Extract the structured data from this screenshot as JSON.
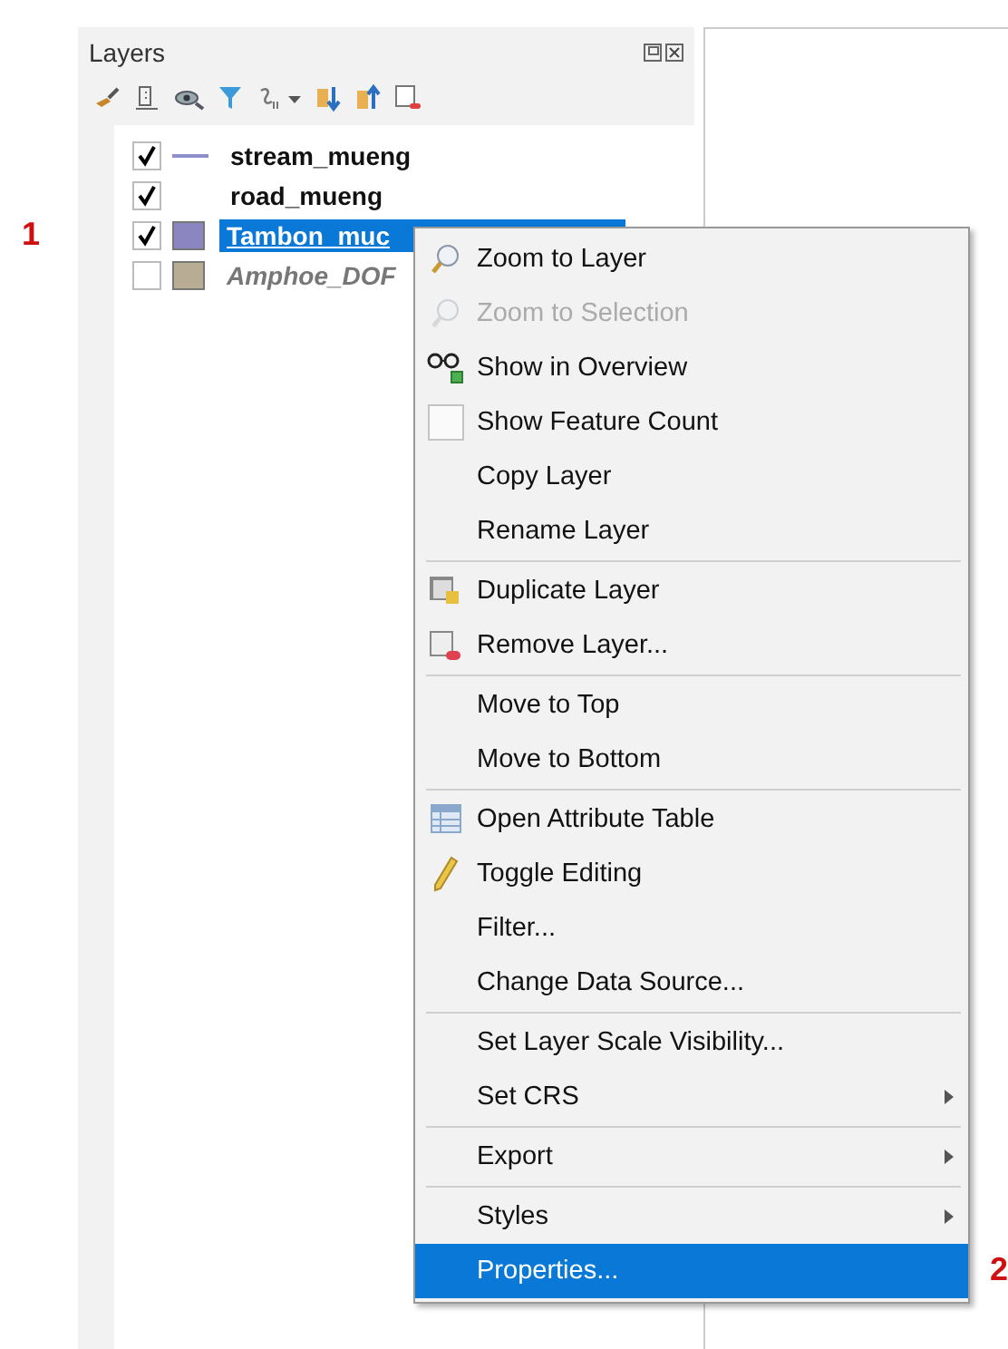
{
  "panel": {
    "title": "Layers"
  },
  "layers": [
    {
      "name": "stream_mueng",
      "kind": "line",
      "color": "#8e8ec8",
      "checked": true,
      "selected": false
    },
    {
      "name": "road_mueng",
      "kind": "none",
      "checked": true,
      "selected": false
    },
    {
      "name": "Tambon_muc",
      "kind": "fill",
      "color": "#8c86c0",
      "checked": true,
      "selected": true
    },
    {
      "name": "Amphoe_DOF",
      "kind": "fill",
      "color": "#b8ac94",
      "checked": false,
      "selected": false
    }
  ],
  "menu": [
    {
      "kind": "zoom",
      "label": "Zoom to Layer",
      "disabled": false,
      "selected": false
    },
    {
      "kind": "zoom",
      "label": "Zoom to Selection",
      "disabled": true,
      "selected": false
    },
    {
      "kind": "overview",
      "label": "Show in Overview",
      "disabled": false,
      "selected": false
    },
    {
      "kind": "checkbox",
      "label": "Show Feature Count",
      "disabled": false,
      "selected": false
    },
    {
      "kind": "plain",
      "label": "Copy Layer",
      "disabled": false,
      "selected": false
    },
    {
      "kind": "plain",
      "label": "Rename Layer",
      "disabled": false,
      "selected": false
    },
    {
      "kind": "separator"
    },
    {
      "kind": "duplicate",
      "label": "Duplicate Layer",
      "disabled": false,
      "selected": false
    },
    {
      "kind": "remove",
      "label": "Remove Layer...",
      "disabled": false,
      "selected": false
    },
    {
      "kind": "separator"
    },
    {
      "kind": "plain",
      "label": "Move to Top",
      "disabled": false,
      "selected": false
    },
    {
      "kind": "plain",
      "label": "Move to Bottom",
      "disabled": false,
      "selected": false
    },
    {
      "kind": "separator"
    },
    {
      "kind": "table",
      "label": "Open Attribute Table",
      "disabled": false,
      "selected": false
    },
    {
      "kind": "pencil",
      "label": "Toggle Editing",
      "disabled": false,
      "selected": false
    },
    {
      "kind": "plain",
      "label": "Filter...",
      "disabled": false,
      "selected": false
    },
    {
      "kind": "plain",
      "label": "Change Data Source...",
      "disabled": false,
      "selected": false
    },
    {
      "kind": "separator"
    },
    {
      "kind": "plain",
      "label": "Set Layer Scale Visibility...",
      "disabled": false,
      "selected": false
    },
    {
      "kind": "submenu",
      "label": "Set CRS",
      "disabled": false,
      "selected": false
    },
    {
      "kind": "separator"
    },
    {
      "kind": "submenu",
      "label": "Export",
      "disabled": false,
      "selected": false
    },
    {
      "kind": "separator"
    },
    {
      "kind": "submenu",
      "label": "Styles",
      "disabled": false,
      "selected": false
    },
    {
      "kind": "plain",
      "label": "Properties...",
      "disabled": false,
      "selected": true
    }
  ],
  "annotations": [
    "1",
    "2"
  ]
}
